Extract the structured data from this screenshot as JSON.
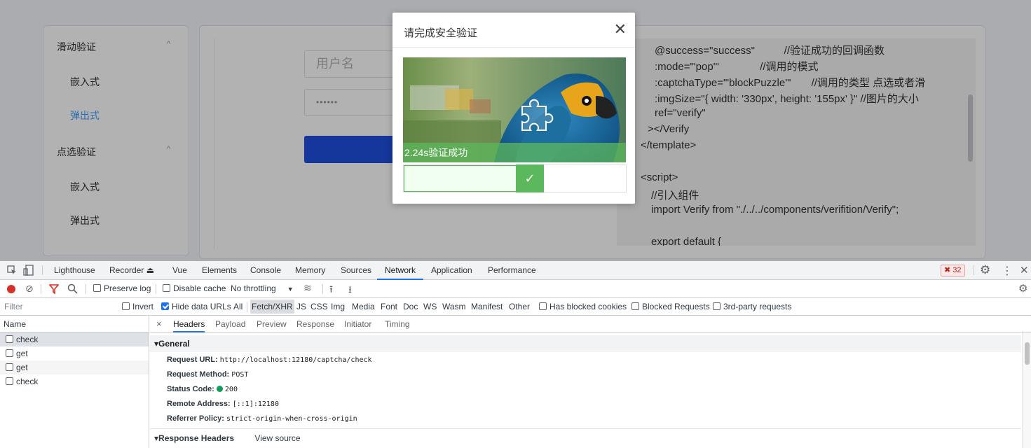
{
  "sidebar": {
    "group1": "滑动验证",
    "group1_items": [
      "嵌入式",
      "弹出式"
    ],
    "group2": "点选验证",
    "group2_items": [
      "嵌入式",
      "弹出式"
    ],
    "active_item": "弹出式",
    "chevron": "^"
  },
  "login": {
    "username_placeholder": "用户名",
    "password_mask": "••••••"
  },
  "code_lines": [
    "@success=\"success\"          //验证成功的回调函数",
    ":mode=\"'pop'\"              //调用的模式",
    ":captchaType=\"'blockPuzzle'\"       //调用的类型 点选或者滑",
    ":imgSize=\"{ width: '330px', height: '155px' }\" //图片的大小",
    "ref=\"verify\"",
    "></Verify",
    "</template>",
    "",
    "<script>",
    "//引入组件",
    "import Verify from \"./../../components/verifition/Verify\";",
    "",
    "export default {"
  ],
  "modal": {
    "title": "请完成安全验证",
    "close": "✕",
    "result_text": "2.24s验证成功",
    "check_mark": "✓"
  },
  "devtools": {
    "tabs": [
      "Lighthouse",
      "Recorder ⏏",
      "Vue",
      "Elements",
      "Console",
      "Memory",
      "Sources",
      "Network",
      "Application",
      "Performance"
    ],
    "active_tab": "Network",
    "error_count": "32",
    "toolbar": {
      "preserve_log": "Preserve log",
      "disable_cache": "Disable cache",
      "throttling": "No throttling"
    },
    "filter": {
      "placeholder": "Filter",
      "invert": "Invert",
      "hide_data_urls": "Hide data URLs",
      "types": [
        "All",
        "Fetch/XHR",
        "JS",
        "CSS",
        "Img",
        "Media",
        "Font",
        "Doc",
        "WS",
        "Wasm",
        "Manifest",
        "Other"
      ],
      "active_type": "Fetch/XHR",
      "has_blocked_cookies": "Has blocked cookies",
      "blocked_requests": "Blocked Requests",
      "third_party": "3rd-party requests"
    },
    "name_header": "Name",
    "requests": [
      "check",
      "get",
      "get",
      "check"
    ],
    "detail_tabs": [
      "×",
      "Headers",
      "Payload",
      "Preview",
      "Response",
      "Initiator",
      "Timing"
    ],
    "active_detail_tab": "Headers",
    "general": {
      "title": "General",
      "rows": [
        {
          "key": "Request URL:",
          "value": "http://localhost:12180/captcha/check"
        },
        {
          "key": "Request Method:",
          "value": "POST"
        },
        {
          "key": "Status Code:",
          "value": "200"
        },
        {
          "key": "Remote Address:",
          "value": "[::1]:12180"
        },
        {
          "key": "Referrer Policy:",
          "value": "strict-origin-when-cross-origin"
        }
      ]
    },
    "response_headers": {
      "title": "Response Headers",
      "view_source": "View source"
    }
  },
  "colors": {
    "accent": "#409eff",
    "login_button": "#1f4fe0",
    "success": "#5cb85c",
    "devtools_active": "#1a73e8"
  }
}
